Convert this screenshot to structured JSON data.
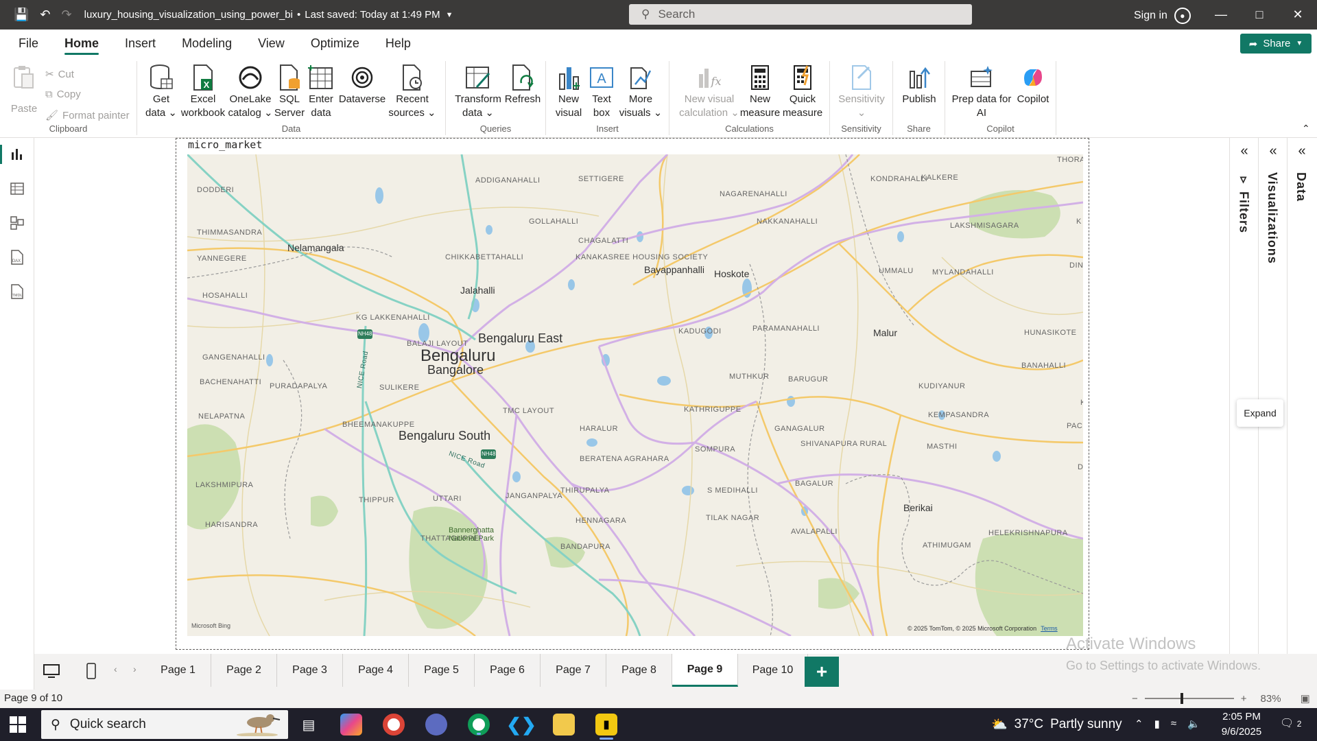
{
  "titlebar": {
    "filename": "luxury_housing_visualization_using_power_bi",
    "saved": "Last saved: Today at 1:49 PM",
    "search_placeholder": "Search",
    "signin": "Sign in"
  },
  "menu": {
    "tabs": [
      "File",
      "Home",
      "Insert",
      "Modeling",
      "View",
      "Optimize",
      "Help"
    ],
    "active": "Home",
    "share_label": "Share"
  },
  "ribbon": {
    "clipboard": {
      "paste": "Paste",
      "cut": "Cut",
      "copy": "Copy",
      "format_painter": "Format painter",
      "label": "Clipboard"
    },
    "data": {
      "get_data": [
        "Get",
        "data"
      ],
      "excel": [
        "Excel",
        "workbook"
      ],
      "onelake": [
        "OneLake",
        "catalog"
      ],
      "sql": [
        "SQL",
        "Server"
      ],
      "enter": [
        "Enter",
        "data"
      ],
      "dataverse": [
        "Dataverse",
        ""
      ],
      "recent": [
        "Recent",
        "sources"
      ],
      "label": "Data"
    },
    "queries": {
      "transform": [
        "Transform",
        "data"
      ],
      "refresh": [
        "Refresh",
        ""
      ],
      "label": "Queries"
    },
    "insert": {
      "new_visual": [
        "New",
        "visual"
      ],
      "text_box": [
        "Text",
        "box"
      ],
      "more_visuals": [
        "More",
        "visuals"
      ],
      "label": "Insert"
    },
    "calculations": {
      "new_visual_calc": [
        "New visual",
        "calculation"
      ],
      "new_measure": [
        "New",
        "measure"
      ],
      "quick_measure": [
        "Quick",
        "measure"
      ],
      "label": "Calculations"
    },
    "sensitivity": {
      "sensitivity": [
        "Sensitivity",
        ""
      ],
      "label": "Sensitivity"
    },
    "share": {
      "publish": [
        "Publish",
        ""
      ],
      "label": "Share"
    },
    "copilot": {
      "prep": [
        "Prep data for",
        "AI"
      ],
      "copilot": [
        "Copilot",
        ""
      ],
      "label": "Copilot"
    }
  },
  "visual": {
    "title": "micro_market",
    "attribution": "© 2025 TomTom, © 2025 Microsoft Corporation",
    "terms": "Terms",
    "bing": "Microsoft Bing"
  },
  "map_labels": {
    "big": [
      "Bengaluru"
    ],
    "large": [
      "Bangalore",
      "Bengaluru East",
      "Bengaluru South"
    ],
    "mid": [
      "Nelamangala",
      "Jalahalli",
      "Bayappanhalli",
      "Hoskote",
      "Malur",
      "Berikai"
    ],
    "small": [
      "DODDERI",
      "THIMMASANDRA",
      "YANNEGERE",
      "HOSAHALLI",
      "GANGENAHALLI",
      "BACHENAHATTI",
      "NELAPATNA",
      "LAKSHMIPURA",
      "HARISANDRA",
      "ADDIGANAHALLI",
      "SETTIGERE",
      "GOLLAHALLI",
      "CHAGALATTI",
      "CHIKKABETTAHALLI",
      "KANAKASREE HOUSING SOCIETY",
      "KG LAKKENAHALLI",
      "BALAJI LAYOUT",
      "PURADAPALYA",
      "SULIKERE",
      "BHEEMANAKUPPE",
      "TMC LAYOUT",
      "HARALUR",
      "KADUGODI",
      "KATHRIGUPPE",
      "GANAGALUR",
      "MUTHKUR",
      "SOMPURA",
      "S MEDIHALLI",
      "TILAK NAGAR",
      "HENNAGARA",
      "THIRUPALYA",
      "BERATENA AGRAHARA",
      "UTTARI",
      "JANGANPALYA",
      "THATTAGUPPE",
      "THIPPUR",
      "BANDAPURA",
      "NAGARENAHALLI",
      "NAKKANAHALLI",
      "KONDRAHALLI",
      "KALKERE",
      "THORA",
      "LAKSHMISAGARA",
      "UMMALU",
      "MYLANDAHALLI",
      "PARAMANAHALLI",
      "HUNASIKOTE",
      "BANAHALLI",
      "KUDIYANUR",
      "KEMPASANDRA",
      "BARUGUR",
      "SHIVANAPURA RURAL",
      "MASTHI",
      "BAGALUR",
      "AVALAPALLI",
      "KONDANAI",
      "PACHA",
      "HELEKRISHNAPURA",
      "ATHIMUGAM",
      "DIN",
      "K",
      "Do"
    ],
    "green": [
      "Bannerghatta National Park"
    ],
    "roads": [
      "NICE Road",
      "NICE Road"
    ],
    "shields": [
      "NH48",
      "NH48"
    ]
  },
  "panes": {
    "filters": "Filters",
    "visualizations": "Visualizations",
    "data": "Data",
    "expand_tip": "Expand"
  },
  "pages": {
    "tabs": [
      "Page 1",
      "Page 2",
      "Page 3",
      "Page 4",
      "Page 5",
      "Page 6",
      "Page 7",
      "Page 8",
      "Page 9",
      "Page 10"
    ],
    "active": "Page 9",
    "add": "+"
  },
  "watermark": {
    "line1": "Activate Windows",
    "line2": "Go to Settings to activate Windows."
  },
  "status": {
    "page_info": "Page 9 of 10",
    "zoom": "83%",
    "zoom_level": 0.83
  },
  "taskbar": {
    "search_placeholder": "Quick search",
    "weather_temp": "37°C",
    "weather_desc": "Partly sunny",
    "time": "2:05 PM",
    "date": "9/6/2025",
    "notifications": "2"
  },
  "colors": {
    "accent": "#117865",
    "map_land": "#f2efe6",
    "map_major_road": "#f4c96a",
    "map_highway": "#c9a6e0",
    "map_water": "#8fc2e8",
    "map_green": "#b9d79a"
  }
}
